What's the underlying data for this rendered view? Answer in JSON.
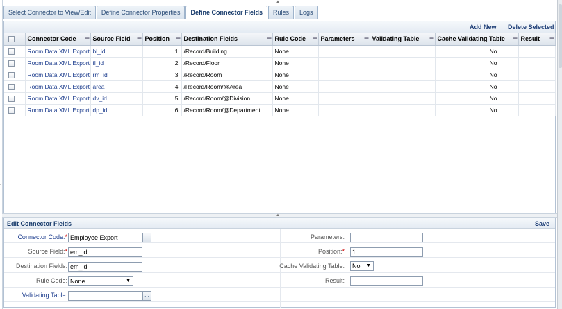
{
  "tabs": [
    {
      "label": "Select Connector to View/Edit",
      "active": false
    },
    {
      "label": "Define Connector Properties",
      "active": false
    },
    {
      "label": "Define Connector Fields",
      "active": true
    },
    {
      "label": "Rules",
      "active": false
    },
    {
      "label": "Logs",
      "active": false
    }
  ],
  "grid": {
    "toolbar": {
      "add_new": "Add New",
      "delete_selected": "Delete Selected"
    },
    "columns": [
      "Connector Code",
      "Source Field",
      "Position",
      "Destination Fields",
      "Rule Code",
      "Parameters",
      "Validating Table",
      "Cache Validating Table",
      "Result"
    ],
    "rows": [
      {
        "connector_code": "Room Data XML Export",
        "source_field": "bl_id",
        "position": "1",
        "destination": "/Record/Building",
        "rule_code": "None",
        "parameters": "",
        "validating_table": "",
        "cache": "No",
        "result": ""
      },
      {
        "connector_code": "Room Data XML Export",
        "source_field": "fl_id",
        "position": "2",
        "destination": "/Record/Floor",
        "rule_code": "None",
        "parameters": "",
        "validating_table": "",
        "cache": "No",
        "result": ""
      },
      {
        "connector_code": "Room Data XML Export",
        "source_field": "rm_id",
        "position": "3",
        "destination": "/Record/Room",
        "rule_code": "None",
        "parameters": "",
        "validating_table": "",
        "cache": "No",
        "result": ""
      },
      {
        "connector_code": "Room Data XML Export",
        "source_field": "area",
        "position": "4",
        "destination": "/Record/Room/@Area",
        "rule_code": "None",
        "parameters": "",
        "validating_table": "",
        "cache": "No",
        "result": ""
      },
      {
        "connector_code": "Room Data XML Export",
        "source_field": "dv_id",
        "position": "5",
        "destination": "/Record/Room/@Division",
        "rule_code": "None",
        "parameters": "",
        "validating_table": "",
        "cache": "No",
        "result": ""
      },
      {
        "connector_code": "Room Data XML Export",
        "source_field": "dp_id",
        "position": "6",
        "destination": "/Record/Room/@Department",
        "rule_code": "None",
        "parameters": "",
        "validating_table": "",
        "cache": "No",
        "result": ""
      }
    ]
  },
  "form": {
    "title": "Edit Connector Fields",
    "save_label": "Save",
    "connector_code": {
      "label": "Connector Code:",
      "value": "Employee Export",
      "required": true
    },
    "source_field": {
      "label": "Source Field:",
      "value": "em_id",
      "required": true
    },
    "destination_fields": {
      "label": "Destination Fields:",
      "value": "em_id"
    },
    "rule_code": {
      "label": "Rule Code:",
      "value": "None"
    },
    "validating_table": {
      "label": "Validating Table:",
      "value": ""
    },
    "parameters": {
      "label": "Parameters:",
      "value": ""
    },
    "position": {
      "label": "Position:",
      "value": "1",
      "required": true
    },
    "cache_validating_table": {
      "label": "Cache Validating Table:",
      "value": "No"
    },
    "result": {
      "label": "Result:",
      "value": ""
    },
    "required_mark": "*",
    "lookup_button": "..."
  },
  "colors": {
    "accent": "#1f3f77",
    "required": "#cc0000",
    "border": "#b3c2d4"
  }
}
